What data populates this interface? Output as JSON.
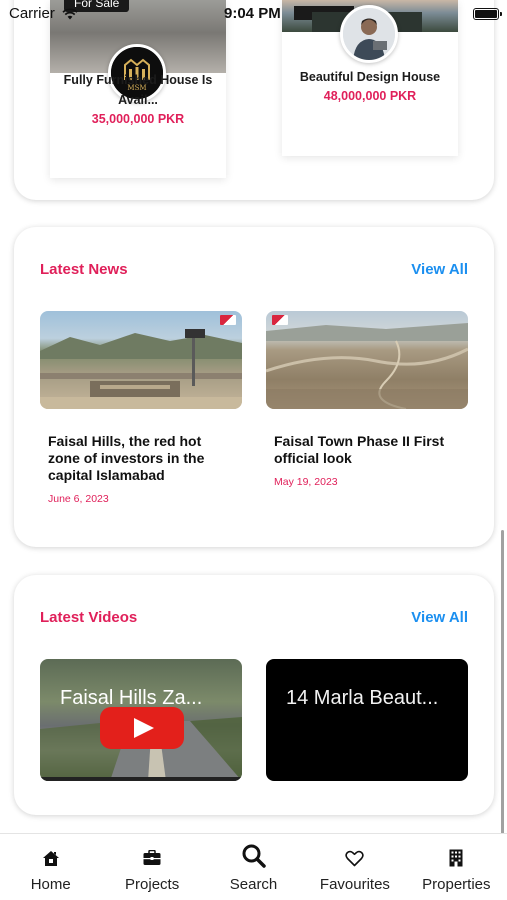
{
  "status_bar": {
    "carrier": "Carrier",
    "time": "9:04 PM"
  },
  "featured_properties": [
    {
      "tag": "For Sale",
      "avatar_text": "MSM",
      "title": "Fully Furnished House Is Avail...",
      "price": "35,000,000 PKR"
    },
    {
      "tag": "",
      "title": "Beautiful Design House",
      "price": "48,000,000 PKR"
    }
  ],
  "news": {
    "title": "Latest News",
    "view_all": "View All",
    "items": [
      {
        "title": "Faisal Hills, the red hot zone of investors in the capital Islamabad",
        "date": "June 6, 2023"
      },
      {
        "title": "Faisal Town Phase II First official look",
        "date": "May 19, 2023"
      }
    ]
  },
  "videos": {
    "title": "Latest Videos",
    "view_all": "View All",
    "items": [
      {
        "title": "Faisal Hills Za..."
      },
      {
        "title": "14 Marla Beaut..."
      }
    ]
  },
  "tabs": [
    {
      "label": "Home",
      "icon": "home-icon"
    },
    {
      "label": "Projects",
      "icon": "briefcase-icon"
    },
    {
      "label": "Search",
      "icon": "search-icon"
    },
    {
      "label": "Favourites",
      "icon": "heart-icon"
    },
    {
      "label": "Properties",
      "icon": "building-icon"
    }
  ],
  "colors": {
    "accent": "#e0205a",
    "link": "#1b8ff0",
    "text": "#111111"
  }
}
